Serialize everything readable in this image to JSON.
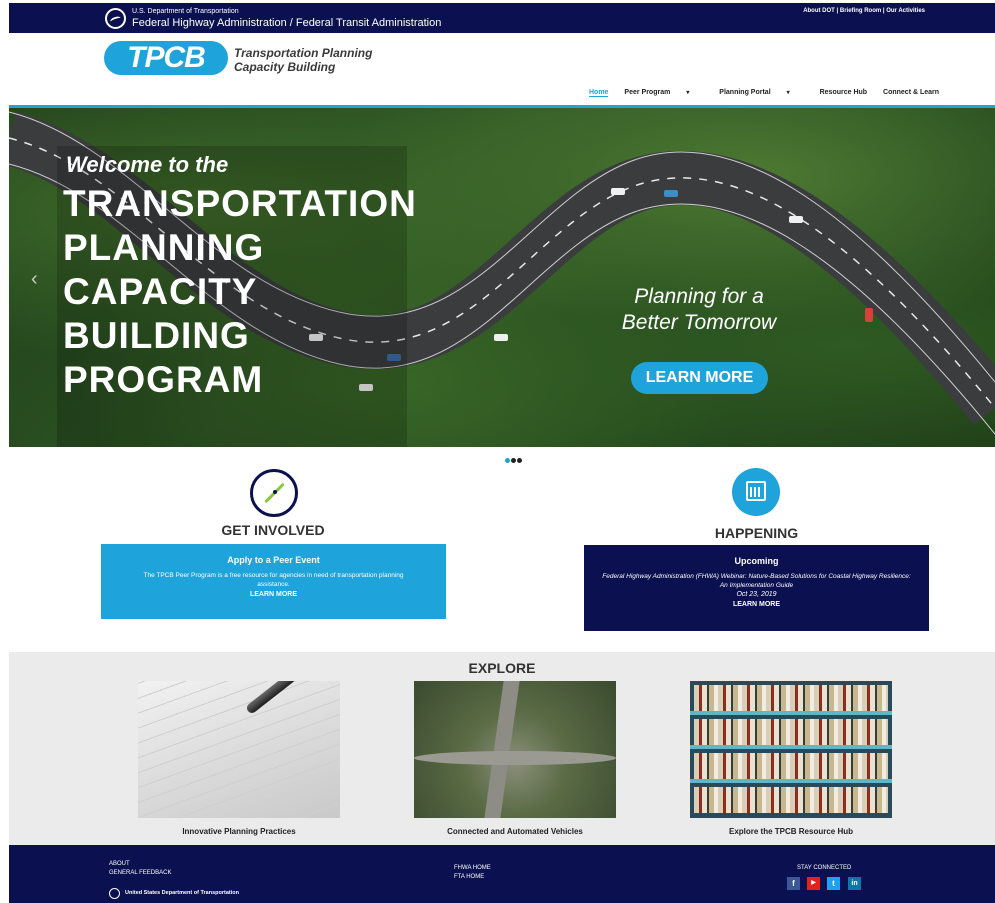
{
  "gov_bar": {
    "department": "U.S. Department of Transportation",
    "agencies": "Federal Highway Administration / Federal Transit Administration",
    "links": "About DOT | Briefing Room | Our Activities"
  },
  "header": {
    "logo": "TPCB",
    "logo_text_line1": "Transportation Planning",
    "logo_text_line2": "Capacity Building"
  },
  "nav": {
    "items": [
      {
        "label": "Home",
        "active": true
      },
      {
        "label": "Peer Program",
        "dropdown": true
      },
      {
        "label": "Planning Portal",
        "dropdown": true
      },
      {
        "label": "Resource Hub"
      },
      {
        "label": "Connect & Learn"
      }
    ]
  },
  "hero": {
    "welcome": "Welcome to the",
    "title_lines": [
      "TRANSPORTATION",
      "PLANNING",
      "CAPACITY",
      "BUILDING",
      "PROGRAM"
    ],
    "tagline_line1": "Planning for a",
    "tagline_line2": "Better Tomorrow",
    "button": "LEARN MORE",
    "slide_count": 3,
    "active_slide": 0
  },
  "get_involved": {
    "icon": "compass-icon",
    "heading": "GET INVOLVED",
    "card_title": "Apply to a Peer Event",
    "card_body": "The TPCB Peer Program is a free resource for agencies in need of transportation planning assistance.",
    "card_link": "LEARN MORE",
    "color": "#1ea3db"
  },
  "happening": {
    "icon": "calendar-icon",
    "heading": "HAPPENING",
    "card_title": "Upcoming",
    "card_body": "Federal Highway Administration (FHWA) Webinar: Nature-Based Solutions for Coastal Highway Resilience: An Implementation Guide",
    "card_date": "Oct 23, 2019",
    "card_link": "LEARN MORE",
    "color": "#0b1150"
  },
  "explore": {
    "heading": "EXPLORE",
    "tiles": [
      {
        "caption": "Innovative Planning Practices",
        "image": "pen-on-paper"
      },
      {
        "caption": "Connected and Automated Vehicles",
        "image": "highway-interchange"
      },
      {
        "caption": "Explore the TPCB Resource Hub",
        "image": "bookshelf"
      }
    ]
  },
  "footer": {
    "about": "ABOUT",
    "feedback": "GENERAL FEEDBACK",
    "dot": "United States Department of Transportation",
    "fhwa_home": "FHWA HOME",
    "fta_home": "FTA HOME",
    "stay_connected": "STAY CONNECTED",
    "social": [
      {
        "name": "facebook-icon",
        "glyph": "f",
        "color": "#3b5998"
      },
      {
        "name": "youtube-icon",
        "glyph": "▶",
        "color": "#e62117"
      },
      {
        "name": "twitter-icon",
        "glyph": "t",
        "color": "#1da1f2"
      },
      {
        "name": "linkedin-icon",
        "glyph": "in",
        "color": "#0e76a8"
      }
    ]
  },
  "colors": {
    "navy": "#0b1150",
    "accent": "#1ea3db"
  }
}
